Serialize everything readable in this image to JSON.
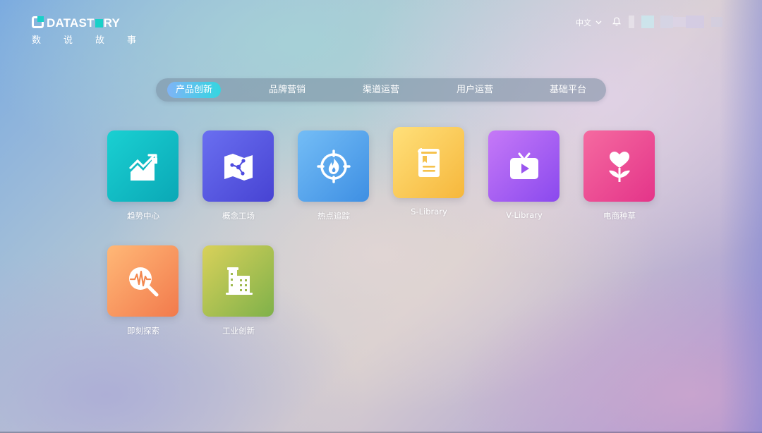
{
  "logo": {
    "wordmark_pre": "DATAST",
    "wordmark_post": "RY",
    "subtitle_chars": [
      "数",
      "说",
      "故",
      "事"
    ]
  },
  "header": {
    "language": "中文",
    "icons": [
      "chevron-down-icon",
      "bell-icon"
    ]
  },
  "tabs": [
    {
      "label": "产品创新",
      "active": true
    },
    {
      "label": "品牌营销",
      "active": false
    },
    {
      "label": "渠道运营",
      "active": false
    },
    {
      "label": "用户运营",
      "active": false
    },
    {
      "label": "基础平台",
      "active": false
    }
  ],
  "apps": [
    {
      "label": "趋势中心",
      "icon": "trend-chart-icon",
      "colors": [
        "#1ad0d2",
        "#0aa8b6"
      ]
    },
    {
      "label": "概念工场",
      "icon": "map-network-icon",
      "colors": [
        "#6a6ff0",
        "#4743d3"
      ]
    },
    {
      "label": "热点追踪",
      "icon": "flame-target-icon",
      "colors": [
        "#74bdf6",
        "#3e8fe3"
      ]
    },
    {
      "label": "S-Library",
      "icon": "book-icon",
      "colors": [
        "#ffe07a",
        "#f6b73c"
      ]
    },
    {
      "label": "V-Library",
      "icon": "tv-play-icon",
      "colors": [
        "#c679f7",
        "#8a49ee"
      ]
    },
    {
      "label": "电商种草",
      "icon": "heart-sprout-icon",
      "colors": [
        "#f56aa0",
        "#e43489"
      ]
    },
    {
      "label": "即刻探索",
      "icon": "pulse-search-icon",
      "colors": [
        "#ffb877",
        "#f27a4c"
      ]
    },
    {
      "label": "工业创新",
      "icon": "building-icon",
      "colors": [
        "#d9d15a",
        "#7fb14a"
      ]
    }
  ]
}
